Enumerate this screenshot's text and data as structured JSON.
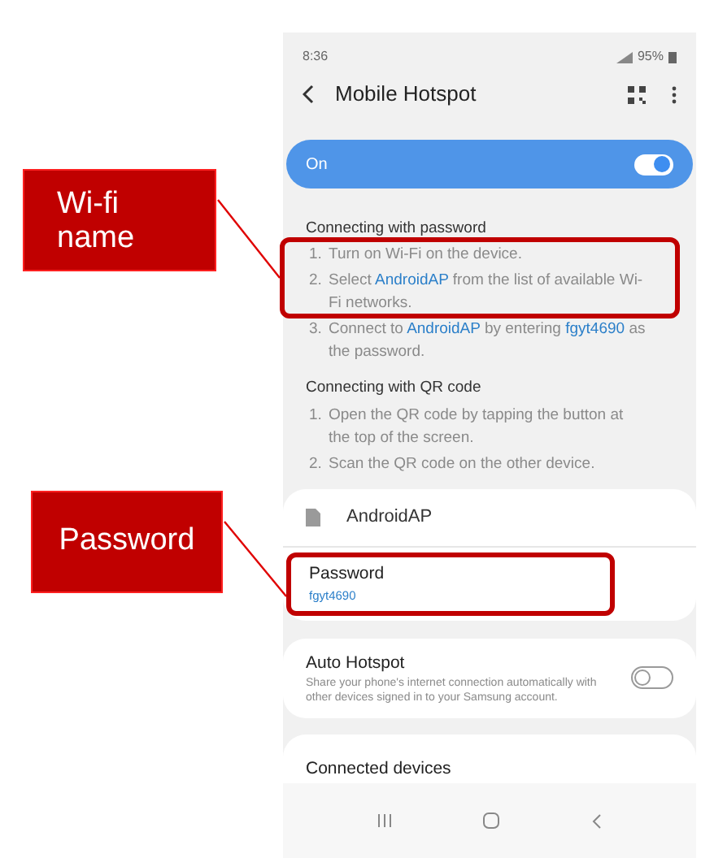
{
  "status_bar": {
    "time": "8:36",
    "battery": "95%"
  },
  "header": {
    "title": "Mobile Hotspot"
  },
  "master_switch": {
    "label": "On",
    "on": true
  },
  "sections": [
    {
      "title": "Connecting with password",
      "steps": [
        {
          "number": "1.",
          "parts": [
            {
              "kind": "plain",
              "text": "Turn on Wi-Fi on the device."
            }
          ]
        },
        {
          "number": "2.",
          "parts": [
            {
              "kind": "plain",
              "text": "Select "
            },
            {
              "kind": "link",
              "text": "AndroidAP"
            },
            {
              "kind": "plain",
              "text": " from the list of available Wi-Fi networks."
            }
          ]
        },
        {
          "number": "3.",
          "parts": [
            {
              "kind": "plain",
              "text": "Connect to "
            },
            {
              "kind": "link",
              "text": "AndroidAP"
            },
            {
              "kind": "plain",
              "text": " by entering "
            },
            {
              "kind": "link",
              "text": "fgyt4690"
            },
            {
              "kind": "plain",
              "text": " as the password."
            }
          ]
        }
      ]
    },
    {
      "title": "Connecting with QR code",
      "steps": [
        {
          "number": "1.",
          "parts": [
            {
              "kind": "plain",
              "text": "Open the QR code by tapping the button at the top of the screen."
            }
          ]
        },
        {
          "number": "2.",
          "parts": [
            {
              "kind": "plain",
              "text": "Scan the QR code on the other device."
            }
          ]
        }
      ]
    }
  ],
  "network": {
    "name": "AndroidAP",
    "password_label": "Password",
    "password": "fgyt4690"
  },
  "auto_hotspot": {
    "title": "Auto Hotspot",
    "description": "Share your phone's internet connection automatically with other devices signed in to your Samsung account.",
    "on": false
  },
  "connected_devices": {
    "title": "Connected devices"
  },
  "annotations": [
    {
      "label": "Wi-fi name"
    },
    {
      "label": "Password"
    }
  ]
}
